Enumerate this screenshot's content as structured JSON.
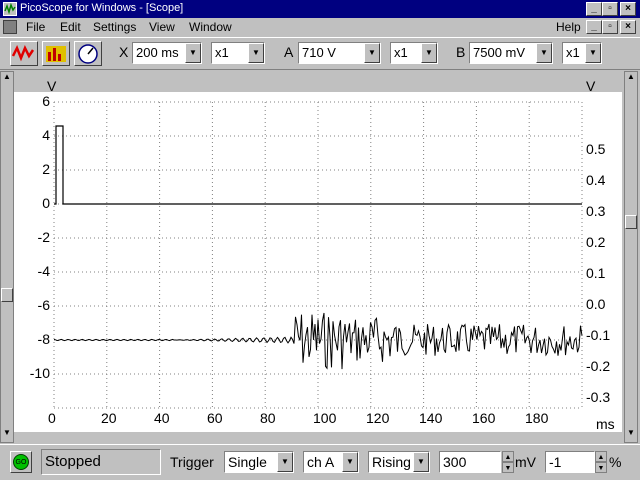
{
  "window": {
    "title": "PicoScope for Windows - [Scope]"
  },
  "menu": [
    "File",
    "Edit",
    "Settings",
    "View",
    "Window"
  ],
  "menu_help": "Help",
  "toolbar": {
    "x_label": "X",
    "x_timebase": "200 ms",
    "x_mult": "x1",
    "a_label": "A",
    "a_range": "710 V",
    "a_mult": "x1",
    "b_label": "B",
    "b_range": "7500 mV",
    "b_mult": "x1"
  },
  "scope": {
    "left_unit": "V",
    "right_unit": "V",
    "left_ticks": [
      "6",
      "4",
      "2",
      "0",
      "-2",
      "-4",
      "-6",
      "-8",
      "-10"
    ],
    "right_ticks": [
      "0.5",
      "0.4",
      "0.3",
      "0.2",
      "0.1",
      "0.0",
      "-0.1",
      "-0.2",
      "-0.3"
    ],
    "x_ticks": [
      "0",
      "20",
      "40",
      "60",
      "80",
      "100",
      "120",
      "140",
      "160",
      "180"
    ],
    "x_unit": "ms"
  },
  "status": {
    "go_label": "GO",
    "state": "Stopped",
    "trigger_label": "Trigger",
    "trigger_mode": "Single",
    "trigger_channel": "ch A",
    "trigger_edge": "Rising",
    "trigger_level": "300",
    "trigger_unit": "mV",
    "pretrigger": "-1",
    "pretrigger_unit": "%"
  },
  "colors": {
    "titlebar": "#000080",
    "trace": "#000000",
    "go_button": "#00c000"
  }
}
